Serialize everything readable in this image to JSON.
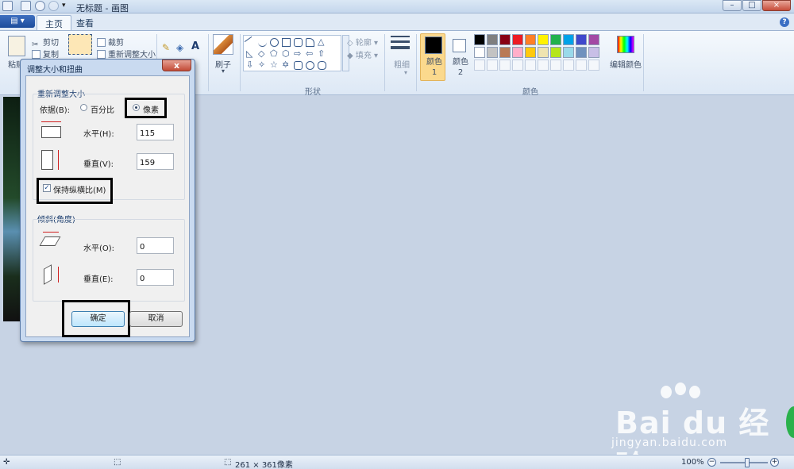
{
  "window": {
    "title": "无标题 - 画图"
  },
  "ribbon": {
    "file_button": "▤ ▾",
    "tabs": [
      {
        "label": "主页",
        "active": true
      },
      {
        "label": "查看",
        "active": false
      }
    ],
    "clipboard": {
      "paste": "粘贴",
      "cut": "剪切",
      "copy": "复制"
    },
    "image": {
      "crop": "裁剪",
      "resize": "重新调整大小"
    },
    "tools": {
      "text_icon": "A"
    },
    "brush": {
      "label": "刷子"
    },
    "shapes": {
      "outline": "轮廓",
      "fill": "填充",
      "group_label": "形状"
    },
    "size": {
      "label": "粗细"
    },
    "colors": {
      "color1_label": "颜色 1",
      "color2_label": "颜色 2",
      "edit_colors": "编辑颜色",
      "group_label": "颜色",
      "color1_value": "#000000",
      "color2_value": "#ffffff",
      "palette_row1": [
        "#000000",
        "#7f7f7f",
        "#880015",
        "#ed1c24",
        "#ff7f27",
        "#fff200",
        "#22b14c",
        "#00a2e8",
        "#3f48cc",
        "#a349a4"
      ],
      "palette_row2": [
        "#ffffff",
        "#c3c3c3",
        "#b97a57",
        "#ffaec9",
        "#ffc90e",
        "#efe4b0",
        "#b5e61d",
        "#99d9ea",
        "#7092be",
        "#c8bfe7"
      ]
    }
  },
  "dialog": {
    "title": "调整大小和扭曲",
    "close": "x",
    "resize_section": "重新调整大小",
    "by_label": "依据(B):",
    "percent_option": "百分比",
    "pixels_option": "像素",
    "pixels_selected": true,
    "horizontal_label": "水平(H):",
    "horizontal_value": "115",
    "vertical_label": "垂直(V):",
    "vertical_value": "159",
    "keep_aspect_label": "保持纵横比(M)",
    "keep_aspect_checked": true,
    "skew_section": "倾斜(角度)",
    "skew_horizontal_label": "水平(O):",
    "skew_horizontal_value": "0",
    "skew_vertical_label": "垂直(E):",
    "skew_vertical_value": "0",
    "ok_button": "确定",
    "cancel_button": "取消"
  },
  "statusbar": {
    "image_size": "261 × 361像素",
    "zoom": "100%",
    "zoom_minus": "−",
    "zoom_plus": "+"
  },
  "watermark": {
    "brand": "Bai du 经验",
    "url": "jingyan.baidu.com"
  }
}
